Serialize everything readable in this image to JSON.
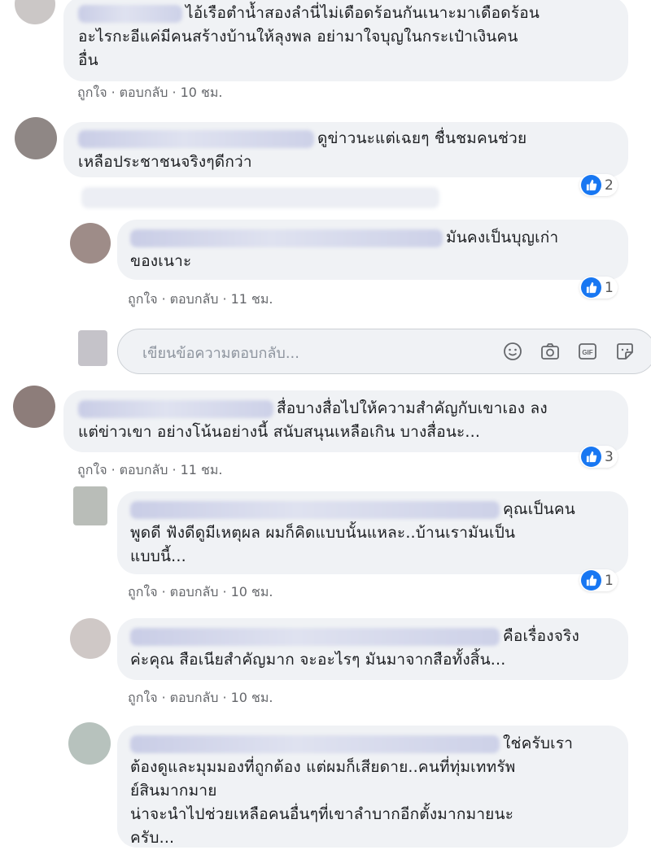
{
  "comments": [
    {
      "text": "ไอ้เรือตำน้ำสองลำนี่ไม่เดือดร้อนกันเนาะมาเดือดร้อน อะไรกะอีแค่มีคนสร้างบ้านให้ลุงพล อย่ามาใจบุญในกระเป๋าเงินคน อื่น",
      "line1": "ไอ้เรือตำน้ำสองลำนี่ไม่เดือดร้อนกันเนาะมาเดือดร้อน",
      "line2": "อะไรกะอีแค่มีคนสร้างบ้านให้ลุงพล อย่ามาใจบุญในกระเป๋าเงินคน",
      "line3": "อื่น",
      "like": "ถูกใจ",
      "reply": "ตอบกลับ",
      "time": "10 ชม."
    },
    {
      "line1": "ดูข่าวนะแต่เฉยๆ ชื่นชมคนช่วย",
      "line2": "เหลือประชาชนจริงๆดีกว่า",
      "reactions": "2"
    },
    {
      "line1": "มันคงเป็นบุญเก่า",
      "line2": "ของเนาะ",
      "like": "ถูกใจ",
      "reply": "ตอบกลับ",
      "time": "11 ชม.",
      "reactions": "1"
    },
    {
      "line1": "สื่อบางสื่อไปให้ความสำคัญกับเขาเอง ลง",
      "line2": "แต่ข่าวเขา อย่างโน้นอย่างนี้ สนับสนุนเหลือเกิน บางสื่อนะ...",
      "like": "ถูกใจ",
      "reply": "ตอบกลับ",
      "time": "11 ชม.",
      "reactions": "3"
    },
    {
      "line1": "คุณเป็นคน",
      "line2": "พูดดี ฟังดีดูมีเหตุผล ผมก็คิดแบบนั้นแหละ..บ้านเรามันเป็น",
      "line3": "แบบนี้...",
      "like": "ถูกใจ",
      "reply": "ตอบกลับ",
      "time": "10 ชม.",
      "reactions": "1"
    },
    {
      "line1": "คือเรื่องจริง",
      "line2": "ค่ะคุณ สือเนียสำคัญมาก จะอะไรๆ มันมาจากสือทั้งสิ้น...",
      "like": "ถูกใจ",
      "reply": "ตอบกลับ",
      "time": "10 ชม."
    },
    {
      "line1": "ใช่ครับเรา",
      "line2": "ต้องดูและมุมมองที่ถูกต้อง แต่ผมก็เสียดาย..คนที่ทุ่มเททรัพ",
      "line3": "ย์สินมากมาย",
      "line4": "น่าจะนำไปช่วยเหลือคนอื่นๆที่เขาลำบากอีกตั้งมากมายนะ",
      "line5": "ครับ..."
    }
  ],
  "composer": {
    "placeholder": "เขียนข้อความตอบกลับ..."
  },
  "colors": {
    "bubble": "#f0f2f5",
    "like_blue": "#1877f2",
    "meta_gray": "#65676b"
  }
}
